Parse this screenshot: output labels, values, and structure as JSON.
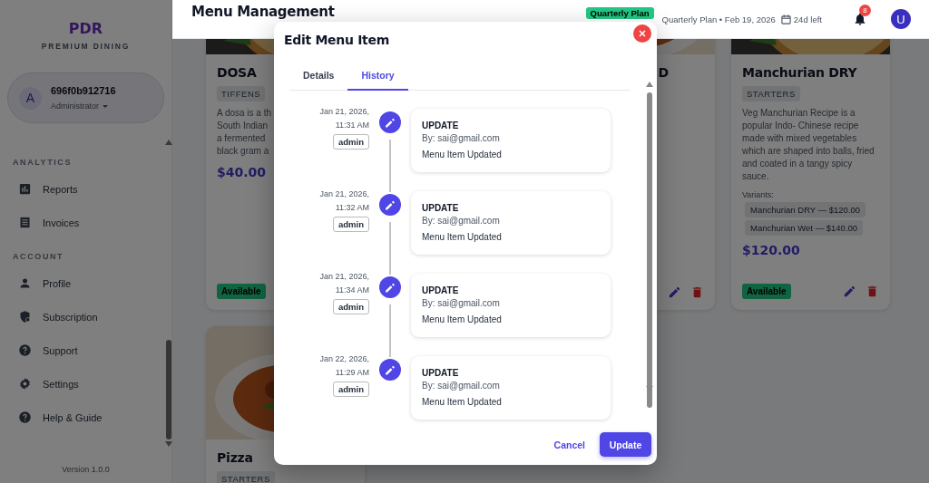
{
  "sidebar": {
    "brand": "PDR",
    "tagline": "PREMIUM DINING",
    "user": {
      "avatar": "A",
      "name": "696f0b912716",
      "role": "Administrator"
    },
    "sections": [
      {
        "title": "ANALYTICS",
        "items": [
          {
            "label": "Reports"
          },
          {
            "label": "Invoices"
          }
        ]
      },
      {
        "title": "ACCOUNT",
        "items": [
          {
            "label": "Profile"
          },
          {
            "label": "Subscription"
          },
          {
            "label": "Support"
          },
          {
            "label": "Settings"
          },
          {
            "label": "Help & Guide"
          }
        ]
      }
    ],
    "version": "Version 1.0.0"
  },
  "header": {
    "title": "Menu Management",
    "plan_badge": "Quarterly Plan",
    "plan_info": "Quarterly Plan • Feb 19, 2026",
    "days_left": "24d left",
    "notifications": "8",
    "avatar": "U"
  },
  "cards": [
    {
      "kind": "dish",
      "title": "DOSA",
      "tag": "TIFFENS",
      "description_lines": [
        "A dosa is a th",
        "South Indian",
        "a fermented",
        "black gram a"
      ],
      "price": "$40.00",
      "status": "Available"
    },
    {
      "kind": "covered",
      "title": "D",
      "actions": true
    },
    {
      "kind": "dish",
      "title": "Manchurian DRY",
      "tag": "STARTERS",
      "description": "Veg Manchurian Recipe is a popular Indo- Chinese recipe made with mixed vegetables which are shaped into balls, fried and coated in a tangy spicy sauce.",
      "variants_label": "Variants:",
      "variants": [
        "Manchurian DRY — $120.00",
        "Manchurian Wet — $140.00"
      ],
      "price": "$120.00",
      "status": "Available",
      "actions": true
    },
    {
      "kind": "dish",
      "title": "Pizza",
      "tag": "STARTERS"
    }
  ],
  "modal": {
    "title": "Edit Menu Item",
    "tabs": [
      {
        "label": "Details",
        "selected": false
      },
      {
        "label": "History",
        "selected": true
      }
    ],
    "history": [
      {
        "date": "Jan 21, 2026,",
        "time": "11:31 AM",
        "role": "admin",
        "action": "UPDATE",
        "by": "By: sai@gmail.com",
        "note": "Menu Item Updated"
      },
      {
        "date": "Jan 21, 2026,",
        "time": "11:32 AM",
        "role": "admin",
        "action": "UPDATE",
        "by": "By: sai@gmail.com",
        "note": "Menu Item Updated"
      },
      {
        "date": "Jan 21, 2026,",
        "time": "11:34 AM",
        "role": "admin",
        "action": "UPDATE",
        "by": "By: sai@gmail.com",
        "note": "Menu Item Updated"
      },
      {
        "date": "Jan 22, 2026,",
        "time": "11:29 AM",
        "role": "admin",
        "action": "UPDATE",
        "by": "By: sai@gmail.com",
        "note": "Menu Item Updated"
      }
    ],
    "cancel": "Cancel",
    "submit": "Update"
  }
}
